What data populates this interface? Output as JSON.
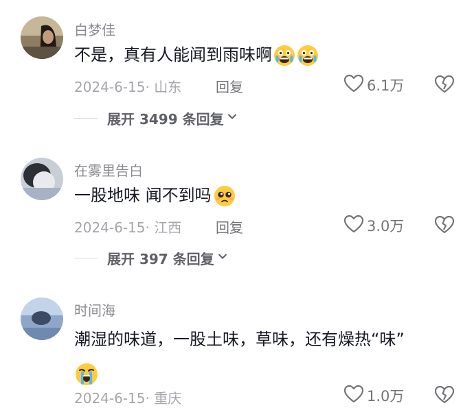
{
  "comments": [
    {
      "username": "白梦佳",
      "text": "不是，真有人能闻到雨味啊",
      "emoji": [
        "crying-scared-face",
        "crying-scared-face"
      ],
      "meta": "2024-6-15· 山东",
      "reply_label": "回复",
      "likes": "6.1万",
      "expand_label": "展开 3499 条回复"
    },
    {
      "username": "在雾里告白",
      "text": "一股地味 闻不到吗",
      "emoji": [
        "pleading-face"
      ],
      "meta": "2024-6-15· 江西",
      "reply_label": "回复",
      "likes": "3.0万",
      "expand_label": "展开 397 条回复"
    },
    {
      "username": "时间海",
      "text": "潮湿的味道，一股土味，草味，还有燥热“味”",
      "emoji": [
        "loudly-crying-face"
      ],
      "meta": "2024-6-15· 重庆",
      "likes": "1.0万"
    }
  ],
  "colors": {
    "username": "#8a8b91",
    "text": "#161823",
    "meta": "#a5a6ab",
    "icon": "#737478"
  }
}
